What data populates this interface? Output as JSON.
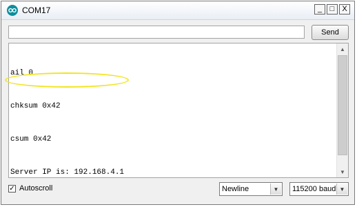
{
  "window": {
    "title": "COM17",
    "icon": "arduino-icon",
    "controls": {
      "minimize": "_",
      "maximize": "□",
      "close": "X"
    }
  },
  "send": {
    "input_value": "",
    "button_label": "Send"
  },
  "console": {
    "lines": [
      "ail 0",
      "chksum 0x42",
      "csum 0x42",
      "Server IP is: 192.168.4.1"
    ],
    "highlight_color": "#f2e41d"
  },
  "footer": {
    "autoscroll_label": "Autoscroll",
    "autoscroll_checked": true,
    "autoscroll_mark": "✓",
    "line_ending": "Newline",
    "baud": "115200 baud"
  }
}
